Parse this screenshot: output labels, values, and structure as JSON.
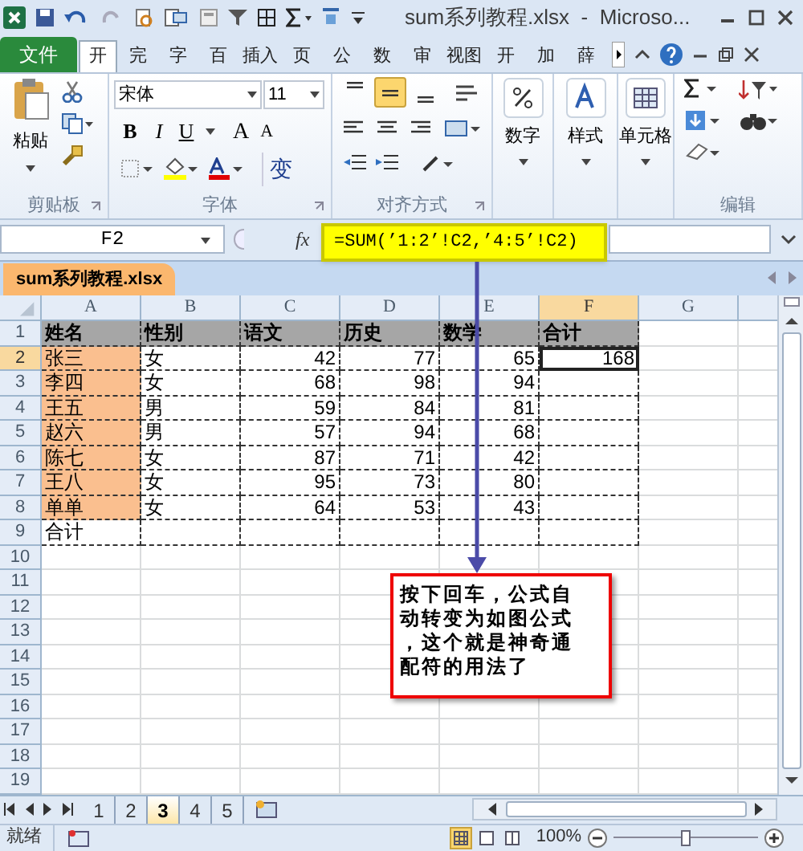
{
  "window": {
    "title": "sum系列教程.xlsx  -  Microso..."
  },
  "ribbon_tabs": [
    {
      "label": "文件",
      "kind": "file",
      "selected": false
    },
    {
      "label": "开",
      "kind": "tab",
      "selected": true
    },
    {
      "label": "完",
      "kind": "tab",
      "selected": false
    },
    {
      "label": "字",
      "kind": "tab",
      "selected": false
    },
    {
      "label": "百",
      "kind": "tab",
      "selected": false
    },
    {
      "label": "插入",
      "kind": "tab",
      "selected": false
    },
    {
      "label": "页",
      "kind": "tab",
      "selected": false
    },
    {
      "label": "公",
      "kind": "tab",
      "selected": false
    },
    {
      "label": "数",
      "kind": "tab",
      "selected": false
    },
    {
      "label": "审",
      "kind": "tab",
      "selected": false
    },
    {
      "label": "视图",
      "kind": "tab",
      "selected": false
    },
    {
      "label": "开",
      "kind": "tab",
      "selected": false
    },
    {
      "label": "加",
      "kind": "tab",
      "selected": false
    },
    {
      "label": "薛",
      "kind": "tab",
      "selected": false
    }
  ],
  "clipboard": {
    "paste": "粘贴",
    "label": "剪贴板"
  },
  "font": {
    "name": "宋体",
    "size": "11",
    "bold": "B",
    "italic": "I",
    "underline": "U",
    "grow": "A",
    "shrink": "A",
    "phonetic": "变",
    "label": "字体"
  },
  "alignment": {
    "label": "对齐方式",
    "buttons": [
      {
        "selected": false
      },
      {
        "selected": true
      },
      {
        "selected": false
      }
    ]
  },
  "big_buttons": [
    {
      "label": "数字",
      "kind": "number"
    },
    {
      "label": "样式",
      "kind": "styles"
    },
    {
      "label": "单元格",
      "kind": "cells"
    }
  ],
  "editing": {
    "label": "编辑"
  },
  "formula_bar": {
    "name_box": "F2",
    "fx": "fx",
    "formula": "=SUM(’1:2’!C2,’4:5’!C2)"
  },
  "workbook_tab": "sum系列教程.xlsx",
  "columns": [
    {
      "label": "A",
      "selected": false
    },
    {
      "label": "B",
      "selected": false
    },
    {
      "label": "C",
      "selected": false
    },
    {
      "label": "D",
      "selected": false
    },
    {
      "label": "E",
      "selected": false
    },
    {
      "label": "F",
      "selected": true
    },
    {
      "label": "G",
      "selected": false
    }
  ],
  "rows": [
    {
      "header": "1",
      "kind": "header",
      "selected": false,
      "cells": [
        "姓名",
        "性别",
        "语文",
        "历史",
        "数学",
        "合计"
      ]
    },
    {
      "header": "2",
      "kind": "data",
      "selected": true,
      "cells": [
        "张三",
        "女",
        "42",
        "77",
        "65",
        "168"
      ]
    },
    {
      "header": "3",
      "kind": "data",
      "selected": false,
      "cells": [
        "李四",
        "女",
        "68",
        "98",
        "94"
      ]
    },
    {
      "header": "4",
      "kind": "data",
      "selected": false,
      "cells": [
        "王五",
        "男",
        "59",
        "84",
        "81"
      ]
    },
    {
      "header": "5",
      "kind": "data",
      "selected": false,
      "cells": [
        "赵六",
        "男",
        "57",
        "94",
        "68"
      ]
    },
    {
      "header": "6",
      "kind": "data",
      "selected": false,
      "cells": [
        "陈七",
        "女",
        "87",
        "71",
        "42"
      ]
    },
    {
      "header": "7",
      "kind": "data",
      "selected": false,
      "cells": [
        "王八",
        "女",
        "95",
        "73",
        "80"
      ]
    },
    {
      "header": "8",
      "kind": "data",
      "selected": false,
      "cells": [
        "单单",
        "女",
        "64",
        "53",
        "43"
      ]
    },
    {
      "header": "9",
      "kind": "total",
      "selected": false,
      "cells": [
        "合计"
      ]
    },
    {
      "header": "10",
      "kind": "empty",
      "selected": false
    },
    {
      "header": "11",
      "kind": "empty",
      "selected": false
    },
    {
      "header": "12",
      "kind": "empty",
      "selected": false
    },
    {
      "header": "13",
      "kind": "empty",
      "selected": false
    },
    {
      "header": "14",
      "kind": "empty",
      "selected": false
    },
    {
      "header": "15",
      "kind": "empty",
      "selected": false
    },
    {
      "header": "16",
      "kind": "empty",
      "selected": false
    },
    {
      "header": "17",
      "kind": "empty",
      "selected": false
    },
    {
      "header": "18",
      "kind": "empty",
      "selected": false
    },
    {
      "header": "19",
      "kind": "empty",
      "selected": false
    }
  ],
  "callout": "按下回车，公式自动转变为如图公式，这个就是神奇通配符的用法了",
  "sheet_tabs": [
    {
      "label": "1",
      "selected": false
    },
    {
      "label": "2",
      "selected": false
    },
    {
      "label": "3",
      "selected": true
    },
    {
      "label": "4",
      "selected": false
    },
    {
      "label": "5",
      "selected": false
    }
  ],
  "status_bar": {
    "text": "就绪",
    "views": [
      {
        "selected": true
      },
      {
        "selected": false
      },
      {
        "selected": false
      }
    ],
    "zoom": "100%",
    "zoom_level": {
      "level": 0.5
    }
  }
}
